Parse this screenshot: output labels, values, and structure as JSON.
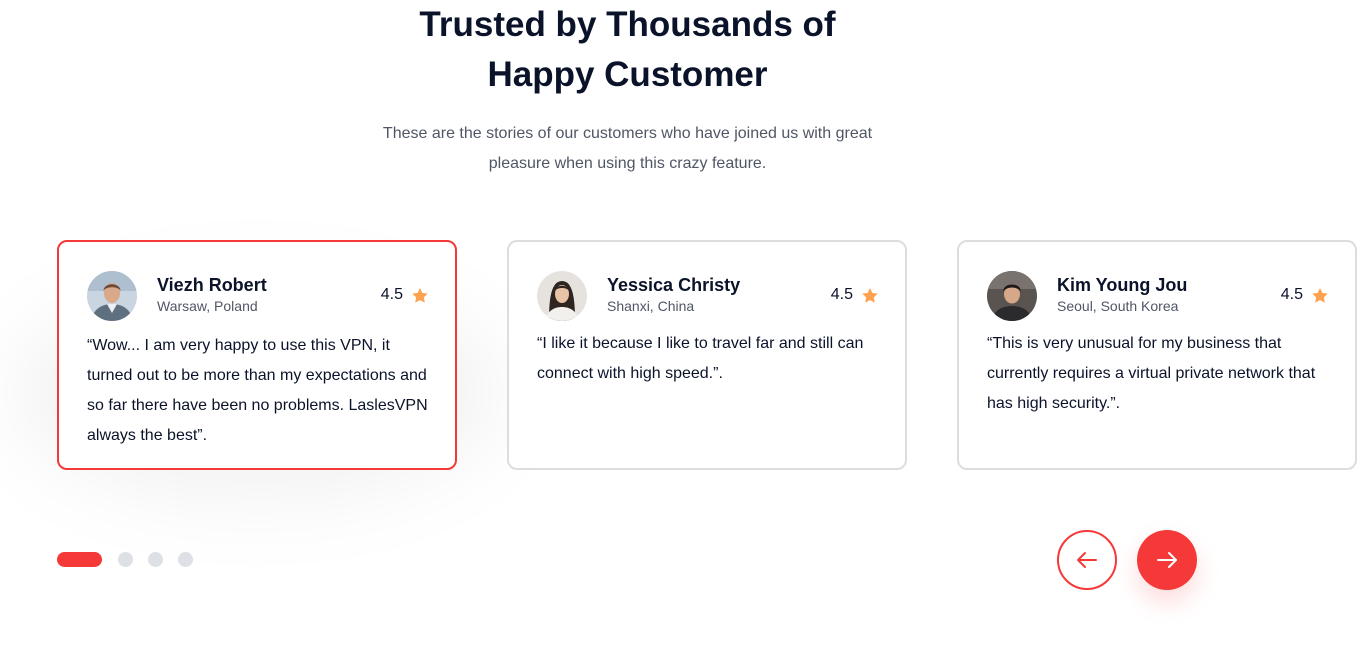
{
  "section": {
    "title_line1": "Trusted by Thousands of",
    "title_line2": "Happy Customer",
    "subtitle_line1": "These are the stories of our customers who have joined us with great",
    "subtitle_line2": "pleasure when using this crazy feature."
  },
  "testimonials": [
    {
      "name": "Viezh Robert",
      "location": "Warsaw, Poland",
      "rating": "4.5",
      "quote": "“Wow... I am very happy to use this VPN, it turned out to be more than my expectations and so far there have been no problems. LaslesVPN always the best”.",
      "active": true
    },
    {
      "name": "Yessica Christy",
      "location": "Shanxi, China",
      "rating": "4.5",
      "quote": "“I like it because I like to travel far and still can connect with high speed.”.",
      "active": false
    },
    {
      "name": "Kim Young Jou",
      "location": "Seoul, South Korea",
      "rating": "4.5",
      "quote": "“This is very unusual for my business that currently requires a virtual private network that has high security.”.",
      "active": false
    }
  ],
  "pagination": {
    "count": 4,
    "active_index": 0
  },
  "navigation": {
    "prev_icon": "arrow-left-icon",
    "next_icon": "arrow-right-icon"
  },
  "colors": {
    "accent": "#F53838",
    "star": "#FEA250",
    "heading": "#0B132A",
    "body_text": "#4F5665",
    "card_border": "#DDDDDD",
    "dot_inactive": "#DDE0E4"
  }
}
